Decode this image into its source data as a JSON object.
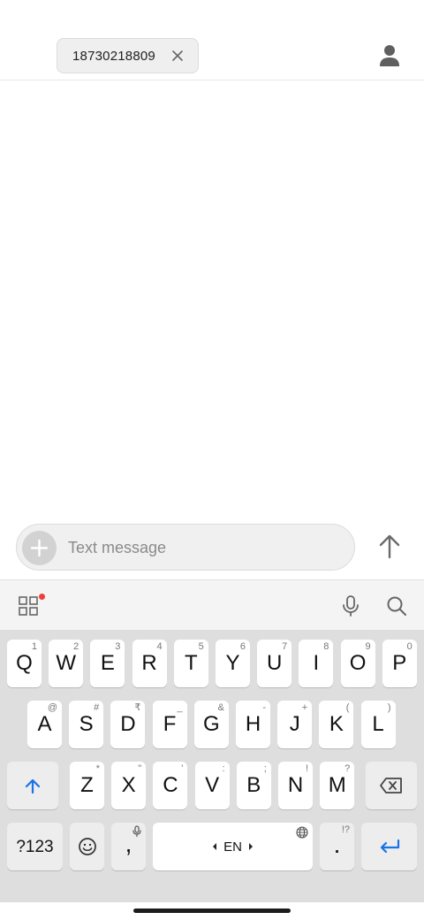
{
  "recipient": {
    "number": "18730218809"
  },
  "compose": {
    "placeholder": "Text message"
  },
  "keyboard": {
    "row1": [
      {
        "label": "Q",
        "hint": "1"
      },
      {
        "label": "W",
        "hint": "2"
      },
      {
        "label": "E",
        "hint": "3"
      },
      {
        "label": "R",
        "hint": "4"
      },
      {
        "label": "T",
        "hint": "5"
      },
      {
        "label": "Y",
        "hint": "6"
      },
      {
        "label": "U",
        "hint": "7"
      },
      {
        "label": "I",
        "hint": "8"
      },
      {
        "label": "O",
        "hint": "9"
      },
      {
        "label": "P",
        "hint": "0"
      }
    ],
    "row2": [
      {
        "label": "A",
        "hint": "@"
      },
      {
        "label": "S",
        "hint": "#"
      },
      {
        "label": "D",
        "hint": "₹"
      },
      {
        "label": "F",
        "hint": "_"
      },
      {
        "label": "G",
        "hint": "&"
      },
      {
        "label": "H",
        "hint": "-"
      },
      {
        "label": "J",
        "hint": "+"
      },
      {
        "label": "K",
        "hint": "("
      },
      {
        "label": "L",
        "hint": ")"
      }
    ],
    "row3": [
      {
        "label": "Z",
        "hint": "*"
      },
      {
        "label": "X",
        "hint": "\""
      },
      {
        "label": "C",
        "hint": "'"
      },
      {
        "label": "V",
        "hint": ":"
      },
      {
        "label": "B",
        "hint": ";"
      },
      {
        "label": "N",
        "hint": "!"
      },
      {
        "label": "M",
        "hint": "?"
      }
    ],
    "symbols_label": "?123",
    "comma_label": ",",
    "space_label": "EN",
    "period_label": ".",
    "period_hint": "!?"
  },
  "icons": {
    "chip_close": "close-icon",
    "contact": "person-icon",
    "add": "plus-icon",
    "send": "arrow-up-icon",
    "toolbar_menu": "grid-icon",
    "toolbar_mic": "mic-icon",
    "toolbar_search": "search-icon",
    "shift": "shift-icon",
    "backspace": "backspace-icon",
    "emoji": "emoji-icon",
    "enter": "enter-icon",
    "globe": "globe-icon"
  },
  "colors": {
    "accent": "#1a73e8",
    "notification_dot": "#ef3e3e",
    "keyboard_bg": "#dedede"
  }
}
